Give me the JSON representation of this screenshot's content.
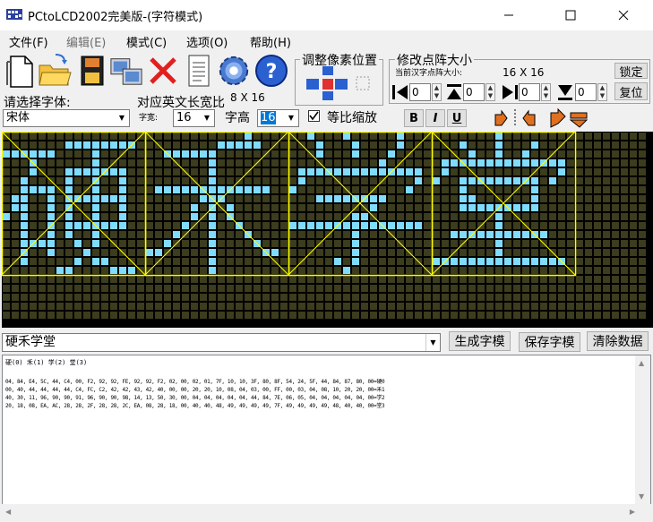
{
  "window": {
    "title": "PCtoLCD2002完美版-(字符模式)"
  },
  "menu": [
    {
      "label": "文件(F)"
    },
    {
      "label": "编辑(E)",
      "disabled": true
    },
    {
      "label": "模式(C)"
    },
    {
      "label": "选项(O)"
    },
    {
      "label": "帮助(H)"
    }
  ],
  "toolbar": {
    "icons": [
      "new-file-icon",
      "open-folder-icon",
      "save-icon",
      "convert-icon",
      "delete-icon",
      "notepad-icon",
      "settings-gear-icon",
      "help-icon"
    ]
  },
  "adjust": {
    "title": "调整像素位置"
  },
  "modify": {
    "title": "修改点阵大小",
    "current_label": "当前汉字点阵大小:",
    "current_size": "16  X  16",
    "lock_label": "锁定",
    "reset_label": "复位",
    "left": "0",
    "top": "0",
    "right": "0",
    "bottom": "0"
  },
  "font": {
    "select_label": "请选择字体:",
    "ratio_label": "对应英文长宽比",
    "ratio_value": "8 X 16",
    "font_name": "宋体",
    "width_label": "字宽:",
    "width_value": "16",
    "height_label": "字高",
    "height_value": "16",
    "proportional_label": "等比缩放",
    "proportional_checked": true,
    "bold_label": "B",
    "italic_label": "I",
    "underline_label": "U"
  },
  "matrix": {
    "rows": 16,
    "glyph_size": 16,
    "chars": [
      "硬",
      "禾",
      "学",
      "堂"
    ],
    "on_color": "#80dcff",
    "off_color": "#3c3c1e",
    "grid_color": "#ffff00"
  },
  "input": {
    "text": "硬禾学堂"
  },
  "actions": {
    "generate": "生成字模",
    "save": "保存字模",
    "clear": "清除数据"
  },
  "output": {
    "header": "硬(0) 禾(1) 学(2) 堂(3)",
    "lines": [
      "04, 84, E4, 5C, 44, C4, 00, F2, 92, 92, FE, 92, 92, F2, 02, 00, 02, 01, 7F, 10, 10, 3F, 80, 8F, 54, 24, 5F, 44, 84, 87, 80, 00=硬0",
      "00, 40, 44, 44, 44, 44, C4, FC, C2, 42, 42, 43, 42, 40, 00, 00, 20, 20, 10, 08, 04, 03, 00, FF, 00, 03, 04, 08, 10, 20, 20, 00=禾1",
      "40, 30, 11, 96, 90, 90, 91, 96, 90, 90, 98, 14, 13, 50, 30, 00, 04, 04, 04, 04, 04, 44, 84, 7E, 06, 05, 04, 04, 04, 04, 04, 00=学2",
      "20, 18, 08, EA, AC, 28, 28, 2F, 28, 28, 2C, EA, 08, 28, 18, 00, 40, 40, 48, 49, 49, 49, 49, 7F, 49, 49, 49, 49, 48, 40, 40, 00=堂3"
    ]
  },
  "colors": {
    "window_bg": "#f0f0f0",
    "grid_line": "#ffff00",
    "pixel_on": "#80dcff"
  }
}
